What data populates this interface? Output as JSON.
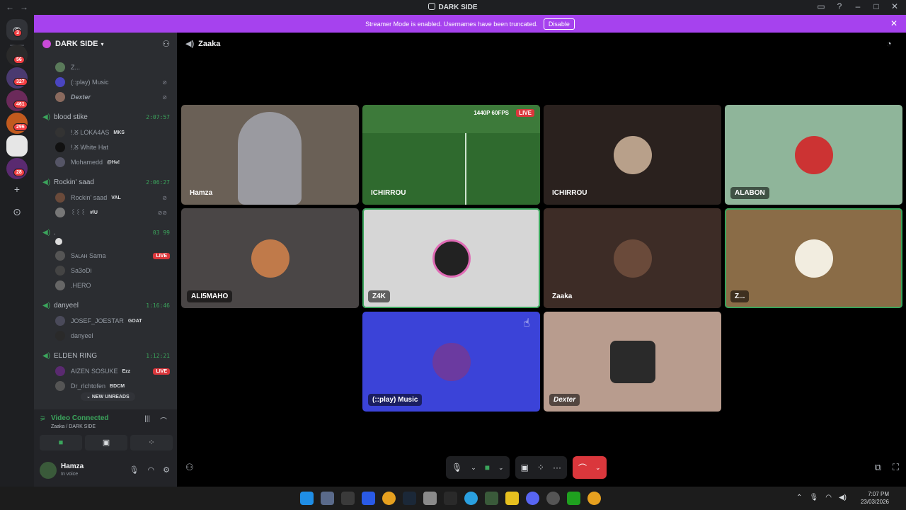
{
  "window": {
    "title": "DARK SIDE"
  },
  "banner": {
    "text": "Streamer Mode is enabled. Usernames have been truncated.",
    "disable_label": "Disable"
  },
  "rail": {
    "badges": [
      "3",
      "56",
      "327",
      "461",
      "296",
      "28"
    ]
  },
  "guild": {
    "name": "DARK SIDE"
  },
  "sidebar": {
    "members_top": [
      {
        "name": "Z..."
      },
      {
        "name": "(::play) Music"
      },
      {
        "name": "Dexter"
      }
    ],
    "channels": [
      {
        "name": "blood stike",
        "timer": "2:07:57",
        "members": [
          {
            "name": "!.ᘜ LOKA4AS",
            "tag": "MKS"
          },
          {
            "name": "!.ᘜ White Hat",
            "tag": ""
          },
          {
            "name": "Mohamedd",
            "tag": "@Hə!"
          }
        ]
      },
      {
        "name": "Rockin' saad",
        "timer": "2:06:27",
        "members": [
          {
            "name": "Rockin' saad",
            "tag": "VAL"
          },
          {
            "name": "꒰꒰꒰",
            "tag": "#/U"
          }
        ]
      },
      {
        "name": ".",
        "timer": "03  99",
        "members": [
          {
            "name": "",
            "tag": ""
          },
          {
            "name": "Sᴀʟᴀʜ Sama",
            "tag": "",
            "live": "LIVE"
          },
          {
            "name": "Sa3oDi",
            "tag": ""
          },
          {
            "name": ".HERO",
            "tag": ""
          }
        ]
      },
      {
        "name": "danyeel",
        "timer": "1:16:46",
        "members": [
          {
            "name": "JOSEF_JOESTAR",
            "tag": "GOAT"
          },
          {
            "name": "danyeel",
            "tag": ""
          }
        ]
      },
      {
        "name": "ELDEN RING",
        "timer": "1:12:21",
        "members": [
          {
            "name": "AIZEN SOSUKE",
            "tag": "Ezz",
            "live": "LIVE"
          },
          {
            "name": "Dr_rlchtofen",
            "tag": "BDCM"
          }
        ]
      }
    ],
    "new_unreads": "NEW UNREADS"
  },
  "voice": {
    "status": "Video Connected",
    "location": "Zaaka / DARK SIDE"
  },
  "user": {
    "name": "Hamza",
    "status": "In voice"
  },
  "call": {
    "channel": "Zaaka",
    "tiles": [
      {
        "label": "Hamza",
        "bg": "#6a6056"
      },
      {
        "label": "ICHIRROU",
        "bg": "#3d7a3a",
        "quality": "1440P 60FPS",
        "live": "LIVE"
      },
      {
        "label": "ICHIRROU",
        "bg": "#2a211e"
      },
      {
        "label": "ALABON",
        "bg": "#8fb59a"
      },
      {
        "label": "ALI5MAHO",
        "bg": "#4a4646"
      },
      {
        "label": "Z4K",
        "bg": "#d6d6d6"
      },
      {
        "label": "Zaaka",
        "bg": "#3d2c26"
      },
      {
        "label": "Z...",
        "bg": "#8a6c47"
      },
      {
        "label": "(::play) Music",
        "bg": "#3b43d8"
      },
      {
        "label": "Dexter",
        "bg": "#b89c8e"
      }
    ]
  },
  "taskbar": {
    "time": "7:07 PM",
    "date": "23/03/2026"
  }
}
